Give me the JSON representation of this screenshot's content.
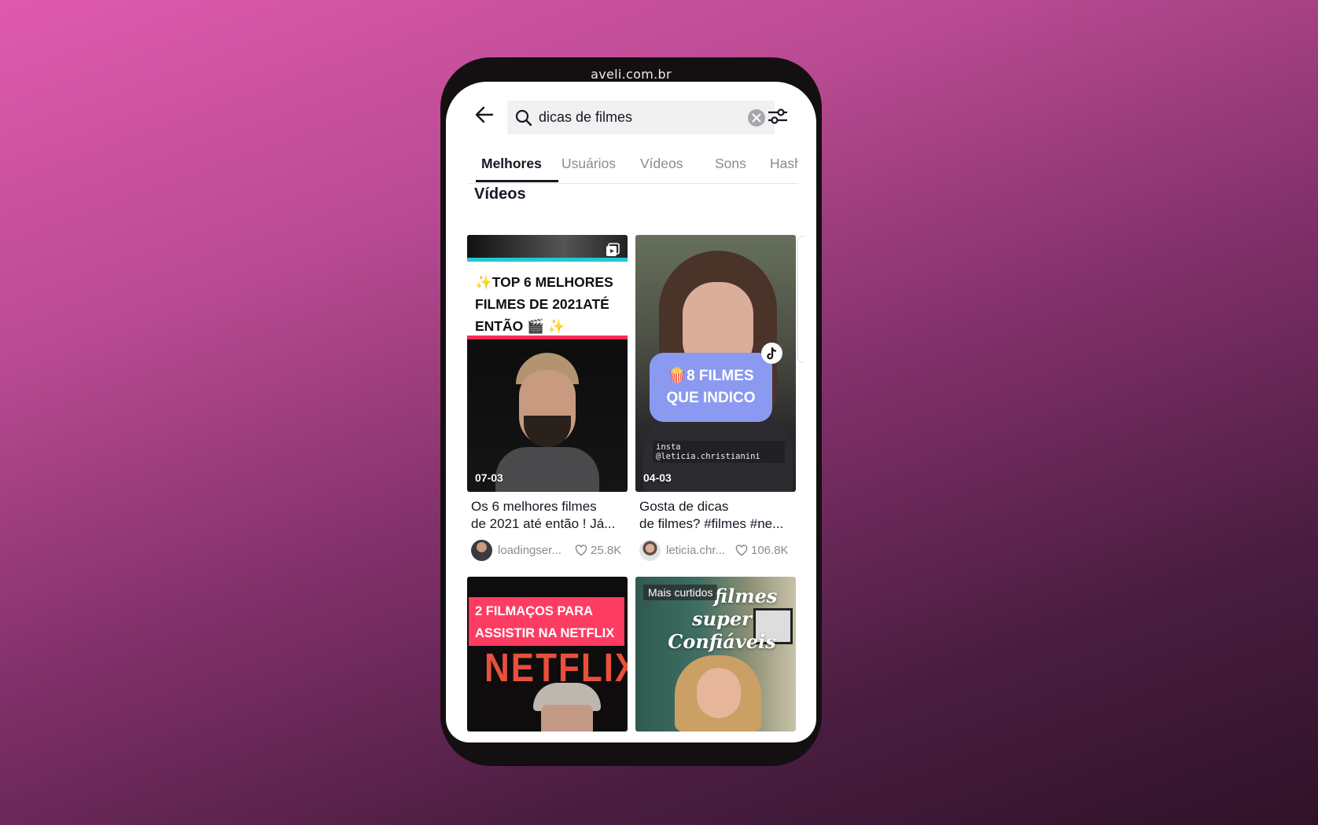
{
  "watermark": "aveli.com.br",
  "search": {
    "query": "dicas de filmes",
    "back_icon": "arrow-left-icon",
    "search_icon": "magnifier-icon",
    "clear_icon": "clear-x-icon",
    "filter_icon": "sliders-icon"
  },
  "tabs": [
    {
      "label": "Melhores",
      "active": true
    },
    {
      "label": "Usuários",
      "active": false
    },
    {
      "label": "Vídeos",
      "active": false
    },
    {
      "label": "Sons",
      "active": false
    },
    {
      "label": "Hasht",
      "active": false
    }
  ],
  "section_title": "Vídeos",
  "videos": [
    {
      "overlay_text": [
        "✨TOP 6 MELHORES",
        "FILMES DE 2021ATÉ",
        "ENTÃO 🎬 ✨"
      ],
      "date": "07-03",
      "caption_line1": "Os 6 melhores filmes",
      "caption_line2": "de 2021 até então ! Já...",
      "username": "loadingser...",
      "likes": "25.8K"
    },
    {
      "overlay_text": [
        "🍿8 FILMES",
        "QUE INDICO"
      ],
      "sub_overlay": "insta @leticia.christianini",
      "date": "04-03",
      "caption_line1": "Gosta de dicas",
      "caption_line2": "de filmes? #filmes #ne...",
      "username": "leticia.chr...",
      "likes": "106.8K"
    },
    {
      "overlay_text": [
        "2 FILMAÇOS PARA",
        "ASSISTIR NA NETFLIX"
      ],
      "logo_text": "NETFLIX"
    },
    {
      "badge": "Mais curtidos",
      "overlay_text": [
        "filmes",
        "super",
        "Confiáveis"
      ]
    }
  ],
  "colors": {
    "accent_text": "#161823",
    "muted_text": "#8a8b91",
    "overlay_pink": "#fe2c55",
    "overlay_cyan": "#25f4ee",
    "overlay_purple": "#8b9af0"
  }
}
